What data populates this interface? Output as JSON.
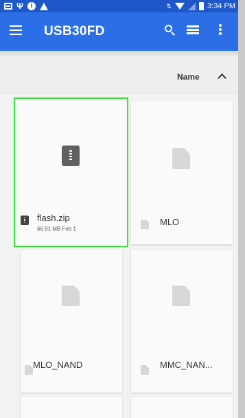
{
  "status_bar": {
    "time": "3:34 PM",
    "left_icons": [
      "screen-icon",
      "usb-icon",
      "info-icon",
      "warning-icon"
    ],
    "right_icons": [
      "data-arrows-icon",
      "wifi-icon",
      "signal-icon",
      "battery-icon"
    ]
  },
  "toolbar": {
    "title": "USB30FD",
    "icons": [
      "menu-icon",
      "search-icon",
      "list-view-icon",
      "more-vert-icon"
    ],
    "color": "#2c6ee6",
    "status_color": "#1e58c8"
  },
  "sort": {
    "label": "Name",
    "direction_icon": "chevron-up-icon"
  },
  "files": [
    {
      "name": "flash.zip",
      "meta": "66.91 MB Feb 1",
      "type": "zip",
      "selected": true
    },
    {
      "name": "MLO",
      "meta": "",
      "type": "file",
      "selected": false
    },
    {
      "name": "MLO_NAND",
      "meta": "",
      "type": "file",
      "selected": false
    },
    {
      "name": "MMC_NAN...",
      "meta": "",
      "type": "file",
      "selected": false
    },
    {
      "name": "",
      "meta": "",
      "type": "file",
      "selected": false
    },
    {
      "name": "",
      "meta": "",
      "type": "file",
      "selected": false
    }
  ],
  "selection_color": "#39e23b"
}
